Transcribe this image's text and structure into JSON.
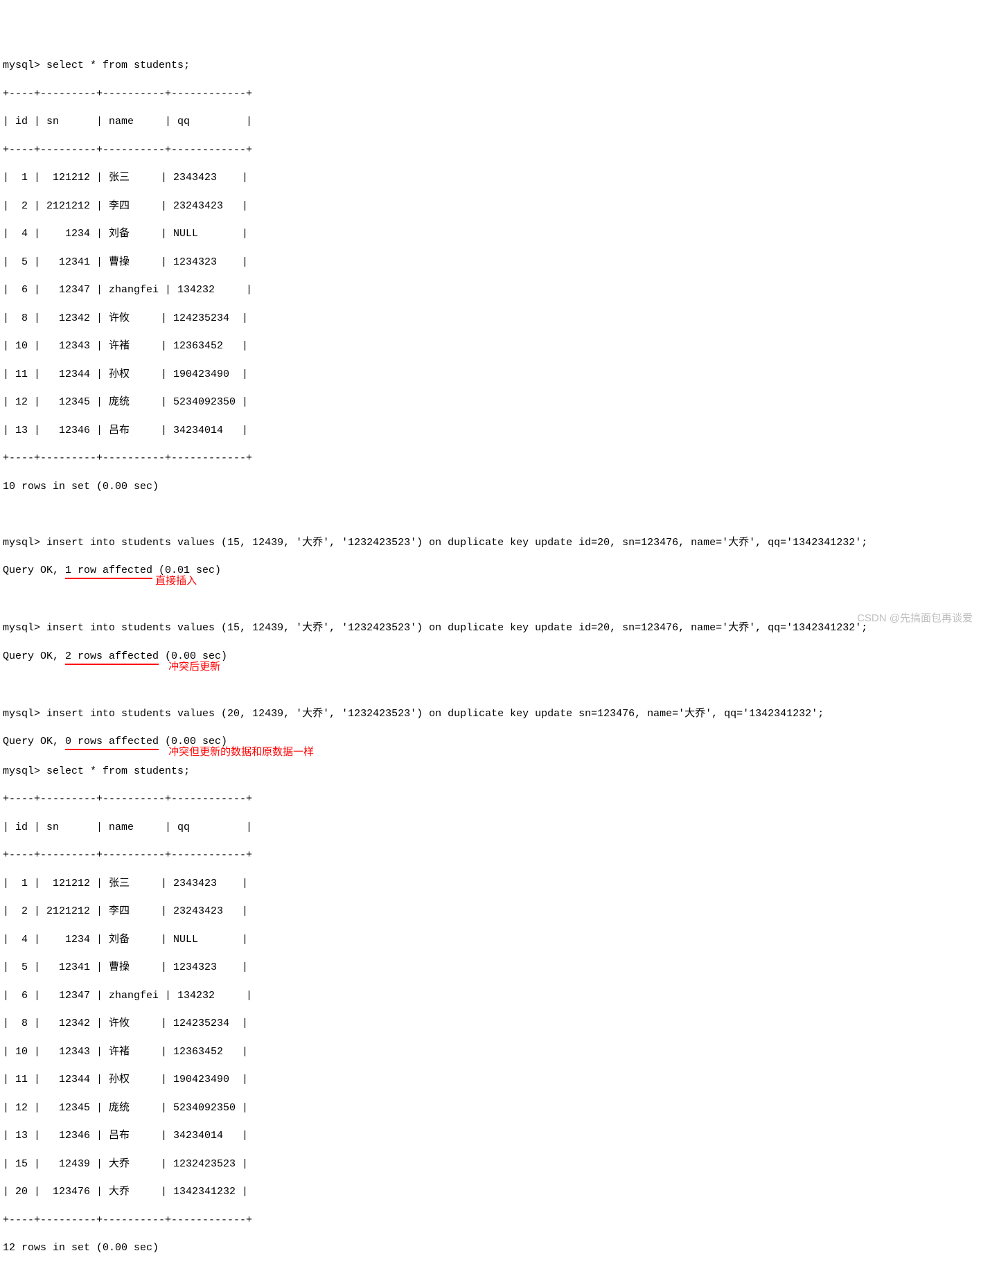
{
  "prompt": "mysql>",
  "query1": "select * from students;",
  "table1": {
    "border_top": "+----+---------+----------+------------+",
    "header": "| id | sn      | name     | qq         |",
    "border_header": "+----+---------+----------+------------+",
    "rows": [
      "|  1 |  121212 | 张三     | 2343423    |",
      "|  2 | 2121212 | 李四     | 23243423   |",
      "|  4 |    1234 | 刘备     | NULL       |",
      "|  5 |   12341 | 曹操     | 1234323    |",
      "|  6 |   12347 | zhangfei | 134232     |",
      "|  8 |   12342 | 许攸     | 124235234  |",
      "| 10 |   12343 | 许褚     | 12363452   |",
      "| 11 |   12344 | 孙权     | 190423490  |",
      "| 12 |   12345 | 庞统     | 5234092350 |",
      "| 13 |   12346 | 吕布     | 34234014   |"
    ],
    "border_bottom": "+----+---------+----------+------------+",
    "footer": "10 rows in set (0.00 sec)"
  },
  "insert1": {
    "cmd": " insert into students values (15, 12439, '大乔', '1232423523') on duplicate key update id=20, sn=123476, name='大乔', qq='1342341232';",
    "result_prefix": "Query OK, ",
    "result_underlined": "1 row affected",
    "result_suffix": " (0.01 sec)",
    "annotation": "直接插入"
  },
  "insert2": {
    "cmd": " insert into students values (15, 12439, '大乔', '1232423523') on duplicate key update id=20, sn=123476, name='大乔', qq='1342341232';",
    "result_prefix": "Query OK, ",
    "result_underlined": "2 rows affected",
    "result_suffix": " (0.00 sec)",
    "annotation": "冲突后更新"
  },
  "insert3": {
    "cmd": " insert into students values (20, 12439, '大乔', '1232423523') on duplicate key update sn=123476, name='大乔', qq='1342341232';",
    "result_prefix": "Query OK, ",
    "result_underlined": "0 rows affected",
    "result_suffix": " (0.00 sec)",
    "annotation": "冲突但更新的数据和原数据一样"
  },
  "query2": "select * from students;",
  "table2": {
    "border_top": "+----+---------+----------+------------+",
    "header": "| id | sn      | name     | qq         |",
    "border_header": "+----+---------+----------+------------+",
    "rows": [
      "|  1 |  121212 | 张三     | 2343423    |",
      "|  2 | 2121212 | 李四     | 23243423   |",
      "|  4 |    1234 | 刘备     | NULL       |",
      "|  5 |   12341 | 曹操     | 1234323    |",
      "|  6 |   12347 | zhangfei | 134232     |",
      "|  8 |   12342 | 许攸     | 124235234  |",
      "| 10 |   12343 | 许褚     | 12363452   |",
      "| 11 |   12344 | 孙权     | 190423490  |",
      "| 12 |   12345 | 庞统     | 5234092350 |",
      "| 13 |   12346 | 吕布     | 34234014   |",
      "| 15 |   12439 | 大乔     | 1232423523 |",
      "| 20 |  123476 | 大乔     | 1342341232 |"
    ],
    "border_bottom": "+----+---------+----------+------------+",
    "footer": "12 rows in set (0.00 sec)"
  },
  "watermark": "CSDN @先搞面包再谈爱"
}
